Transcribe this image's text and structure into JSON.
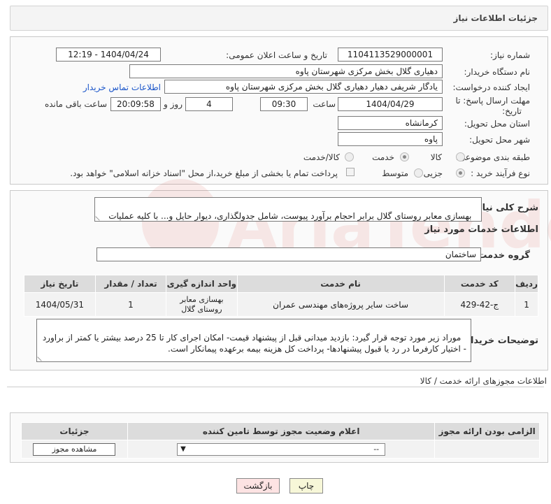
{
  "header": {
    "title": "جزئیات اطلاعات نیاز"
  },
  "form": {
    "need_number_label": "شماره نیاز:",
    "need_number": "1104113529000001",
    "announce_label": "تاریخ و ساعت اعلان عمومی:",
    "announce_value": "1404/04/24 - 12:19",
    "buyer_org_label": "نام دستگاه خریدار:",
    "buyer_org": "دهیاری گلال بخش مرکزی شهرستان پاوه",
    "creator_label": "ایجاد کننده درخواست:",
    "creator": "یادگار شریفی دهیار دهیاری گلال بخش مرکزی شهرستان پاوه",
    "contact_link": "اطلاعات تماس خریدار",
    "deadline_label_1": "مهلت ارسال پاسخ: تا",
    "deadline_label_2": "تاریخ:",
    "deadline_date": "1404/04/29",
    "time_label": "ساعت",
    "deadline_time": "09:30",
    "days_value": "4",
    "days_label": "روز و",
    "remaining_time": "20:09:58",
    "remaining_label": "ساعت باقی مانده",
    "province_label": "استان محل تحویل:",
    "province": "کرمانشاه",
    "city_label": "شهر محل تحویل:",
    "city": "پاوه",
    "category_label": "طبقه بندی موضوعی:",
    "category_options": [
      "کالا",
      "خدمت",
      "کالا/خدمت"
    ],
    "category_selected": "خدمت",
    "process_label": "نوع فرآیند خرید :",
    "process_options": [
      "جزیی",
      "متوسط"
    ],
    "process_selected": "جزیی",
    "payment_note": "پرداخت تمام یا بخشی از مبلغ خرید،از محل \"اسناد خزانه اسلامی\" خواهد بود."
  },
  "summary": {
    "label": "شرح کلی نیاز:",
    "text": "بهسازی معابر روستای گلال برابر احجام برآورد پیوست، شامل جدولگذاری، دیوار حایل و... با کلیه عملیات مربوطه -پروژه به صورت قیمت مقطوع بدون پیش پرداخت است"
  },
  "services": {
    "section_title": "اطلاعات خدمات مورد نیاز",
    "group_label": "گروه خدمت:",
    "group_value": "ساختمان",
    "columns": [
      "ردیف",
      "کد خدمت",
      "نام خدمت",
      "واحد اندازه گیری",
      "تعداد / مقدار",
      "تاریخ نیاز"
    ],
    "rows": [
      {
        "row": "1",
        "code": "ج-42-429",
        "name": "ساخت سایر پروژه‌های مهندسی عمران",
        "unit": "بهسازی معابر روستای گلال",
        "qty": "1",
        "date": "1404/05/31"
      }
    ]
  },
  "buyer_notes": {
    "label": "توضیحات خریدار:",
    "text": "موراد زیر مورد توجه قرار گیرد: بازدید میدانی قبل از پیشنهاد قیمت- امکان اجرای کار تا 25 درصد بیشتر یا کمتر از براورد - اختیار کارفرما در رد یا قبول پیشنهادها- پرداخت کل هزینه بیمه برعهده پیمانکار است."
  },
  "permits": {
    "title": "اطلاعات مجوزهای ارائه خدمت / کالا",
    "columns": [
      "الزامی بودن ارائه مجوز",
      "اعلام وضعیت مجوز توسط تامین کننده",
      "جزئیات"
    ],
    "select_value": "--",
    "view_button": "مشاهده مجوز"
  },
  "actions": {
    "print": "چاپ",
    "back": "بازگشت"
  },
  "watermark": "AriaTender.neT",
  "colors": {
    "link": "#1a55c9",
    "header_bg": "#f4f4f4",
    "table_header": "#dcdcdc",
    "back_button": "#fde3e3",
    "print_button": "#f7f7d8"
  }
}
